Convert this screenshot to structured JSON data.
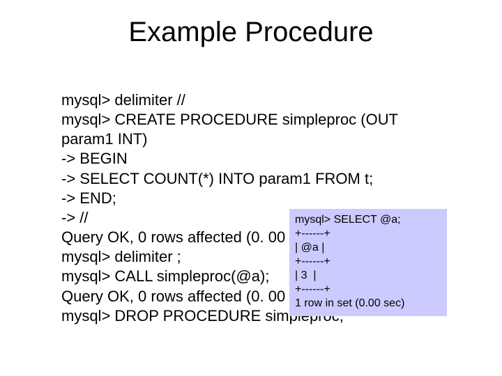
{
  "title": "Example Procedure",
  "code": {
    "l1": "mysql> delimiter //",
    "l2": "mysql> CREATE PROCEDURE simpleproc (OUT",
    "l3": "param1 INT)",
    "l4": "-> BEGIN",
    "l5": "-> SELECT COUNT(*) INTO param1 FROM t;",
    "l6": "-> END;",
    "l7": "-> //",
    "l8": "Query OK, 0 rows affected (0. 00 sec)",
    "l9": "mysql> delimiter ;",
    "l10": "mysql> CALL simpleproc(@a);",
    "l11": "Query OK, 0 rows affected (0. 00 sec)",
    "l12": "mysql> DROP PROCEDURE simpleproc;"
  },
  "result": {
    "r1": "mysql> SELECT @a;",
    "r2": "+------+",
    "r3": "| @a |",
    "r4": "+------+",
    "r5": "| 3  |",
    "r6": "+------+",
    "r7": "1 row in set (0.00 sec)"
  }
}
